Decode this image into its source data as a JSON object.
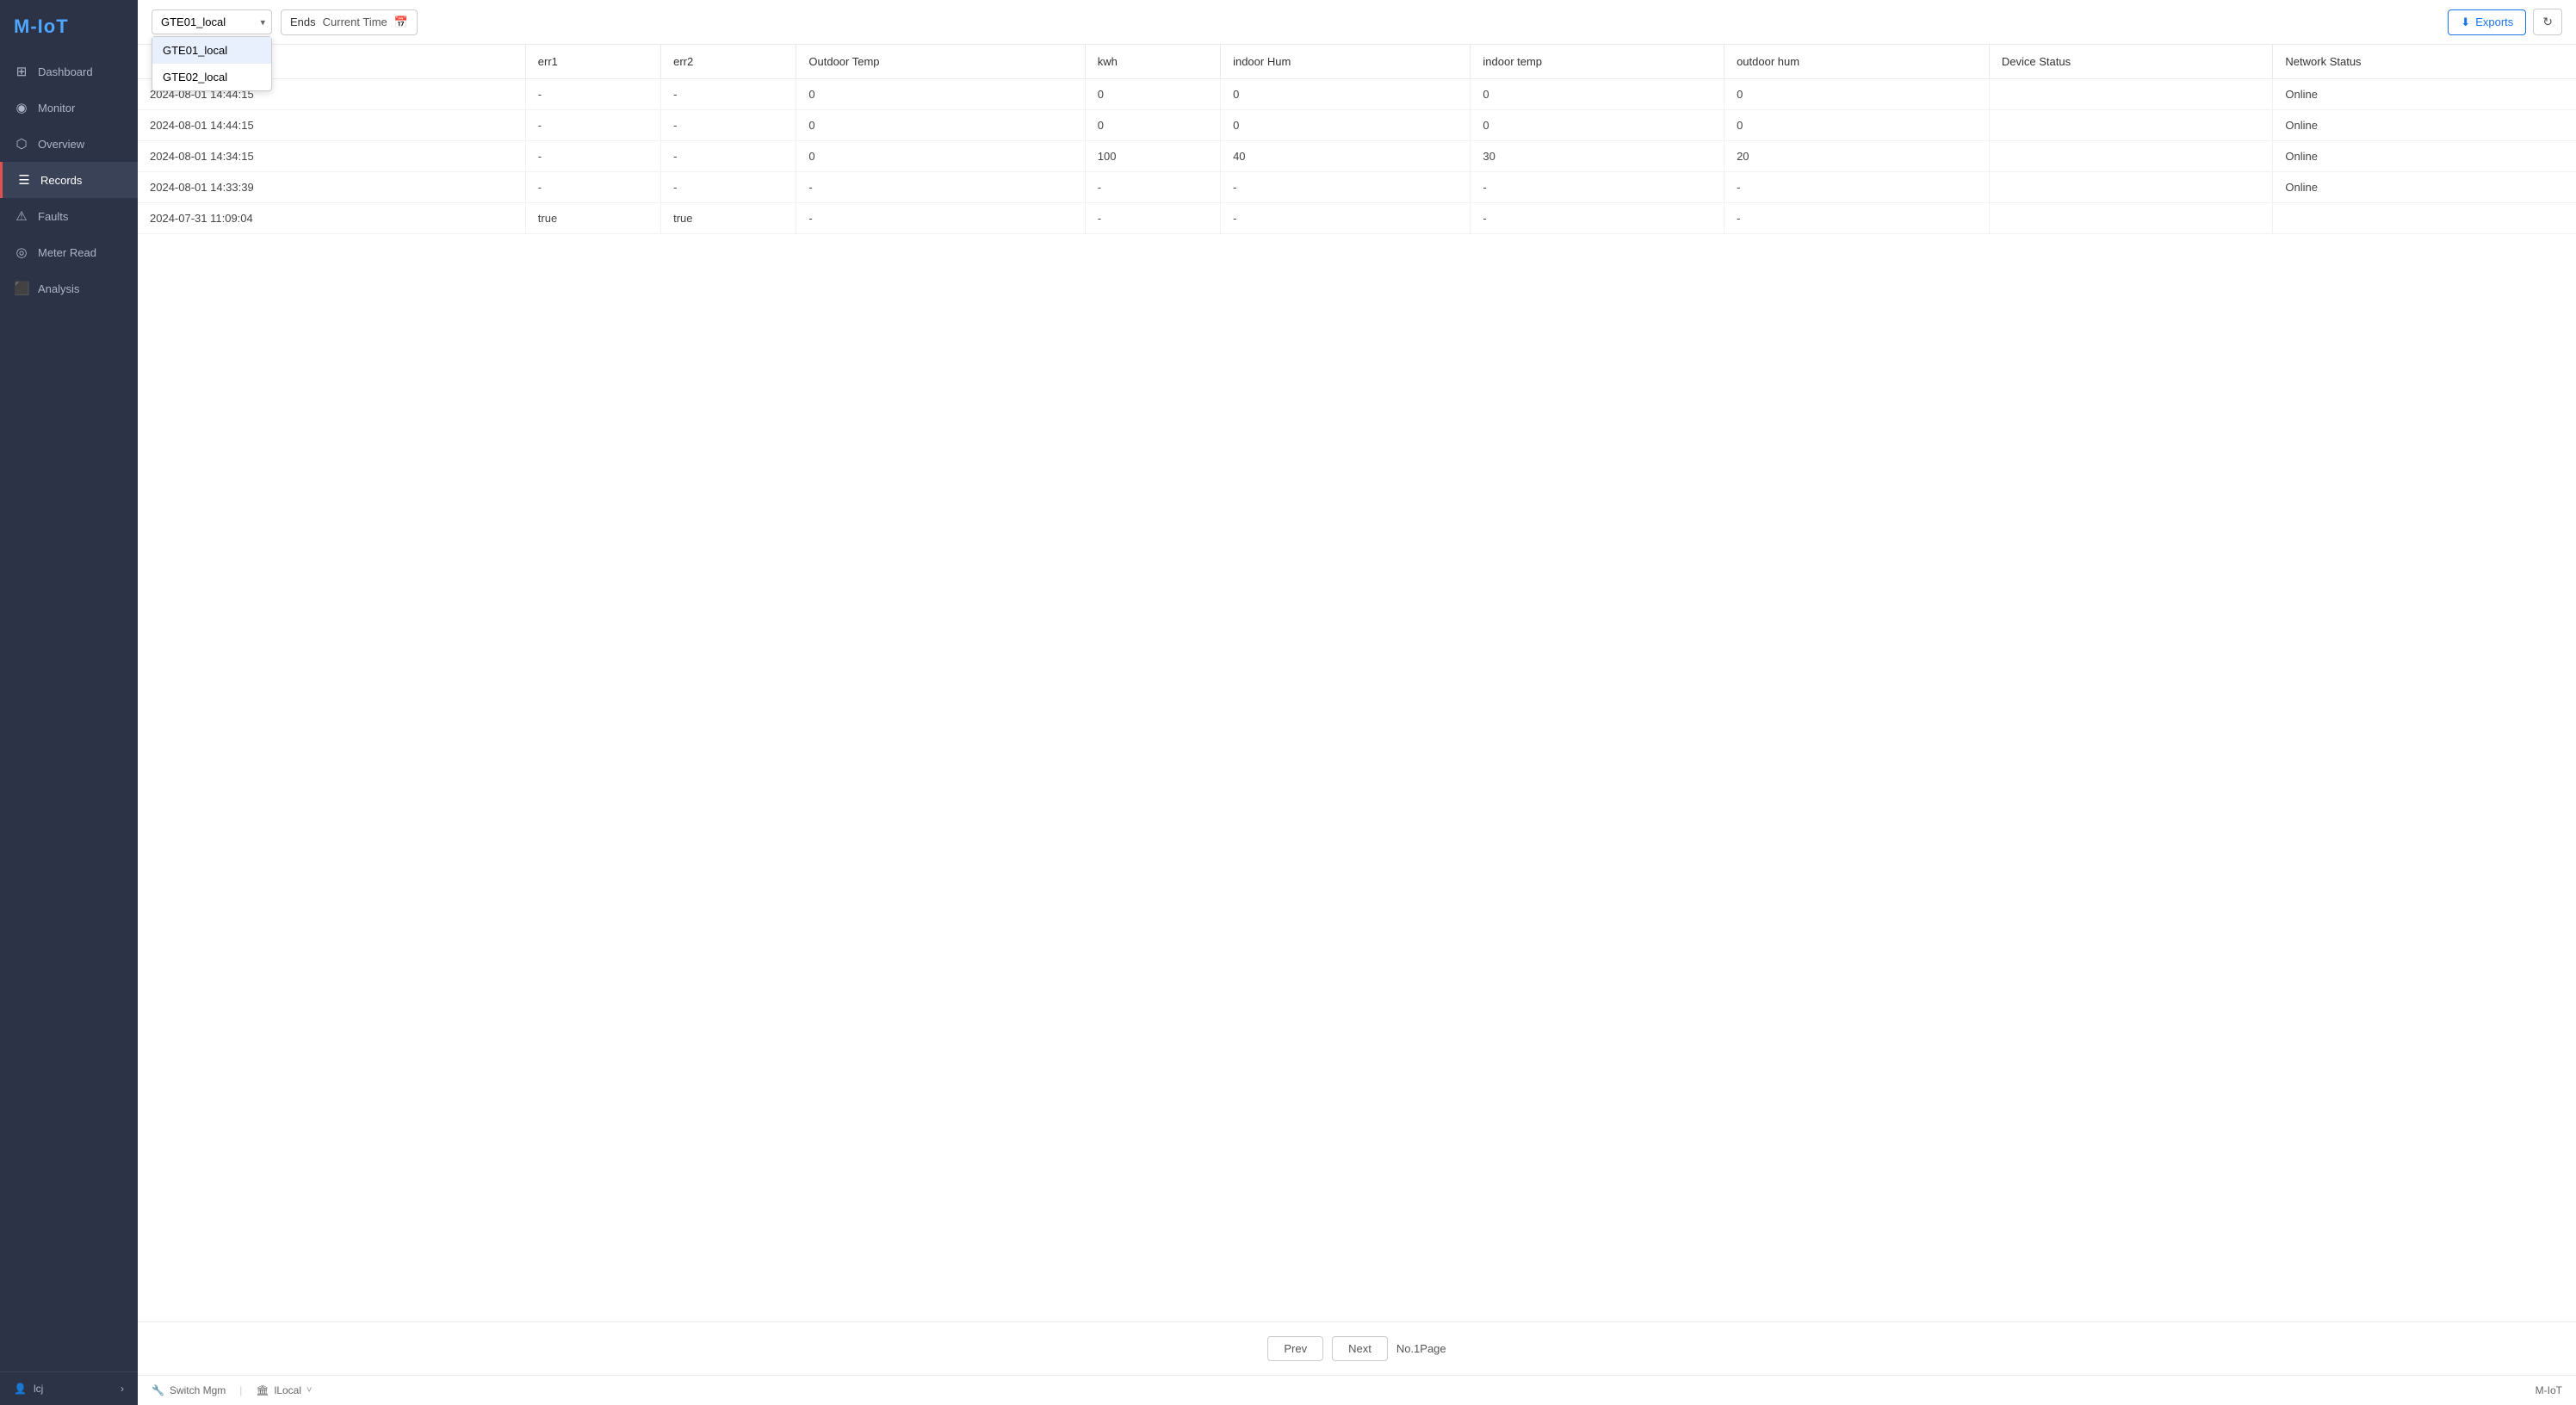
{
  "app": {
    "title": "M-IoT"
  },
  "sidebar": {
    "items": [
      {
        "id": "dashboard",
        "label": "Dashboard",
        "icon": "⊞",
        "active": false
      },
      {
        "id": "monitor",
        "label": "Monitor",
        "icon": "◉",
        "active": false
      },
      {
        "id": "overview",
        "label": "Overview",
        "icon": "⬡",
        "active": false
      },
      {
        "id": "records",
        "label": "Records",
        "icon": "☰",
        "active": true
      },
      {
        "id": "faults",
        "label": "Faults",
        "icon": "⚠",
        "active": false
      },
      {
        "id": "meter-read",
        "label": "Meter Read",
        "icon": "◎",
        "active": false
      },
      {
        "id": "analysis",
        "label": "Analysis",
        "icon": "⬛",
        "active": false
      }
    ],
    "footer": {
      "user": "lcj",
      "user_icon": "👤",
      "arrow_icon": "›"
    }
  },
  "toolbar": {
    "device_selected": "GTE01_local",
    "dropdown_options": [
      {
        "value": "GTE01_local",
        "label": "GTE01_local"
      },
      {
        "value": "GTE02_local",
        "label": "GTE02_local"
      }
    ],
    "date_filter": {
      "ends_label": "Ends",
      "current_time_label": "Current Time"
    },
    "export_label": "Exports",
    "refresh_icon": "↻"
  },
  "table": {
    "columns": [
      {
        "id": "timestamp",
        "label": ""
      },
      {
        "id": "err1",
        "label": "err1"
      },
      {
        "id": "err2",
        "label": "err2"
      },
      {
        "id": "outdoor_temp",
        "label": "Outdoor Temp"
      },
      {
        "id": "kwh",
        "label": "kwh"
      },
      {
        "id": "indoor_hum",
        "label": "indoor Hum"
      },
      {
        "id": "indoor_temp",
        "label": "indoor temp"
      },
      {
        "id": "outdoor_hum",
        "label": "outdoor hum"
      },
      {
        "id": "device_status",
        "label": "Device Status"
      },
      {
        "id": "network_status",
        "label": "Network Status"
      }
    ],
    "rows": [
      {
        "timestamp": "2024-08-01 14:44:15",
        "err1": "-",
        "err2": "-",
        "outdoor_temp": "0",
        "kwh": "0",
        "indoor_hum": "0",
        "indoor_temp": "0",
        "outdoor_hum": "0",
        "device_status": "",
        "network_status": "Online"
      },
      {
        "timestamp": "2024-08-01 14:44:15",
        "err1": "-",
        "err2": "-",
        "outdoor_temp": "0",
        "kwh": "0",
        "indoor_hum": "0",
        "indoor_temp": "0",
        "outdoor_hum": "0",
        "device_status": "",
        "network_status": "Online"
      },
      {
        "timestamp": "2024-08-01 14:34:15",
        "err1": "-",
        "err2": "-",
        "outdoor_temp": "0",
        "kwh": "100",
        "indoor_hum": "40",
        "indoor_temp": "30",
        "outdoor_hum": "20",
        "device_status": "",
        "network_status": "Online"
      },
      {
        "timestamp": "2024-08-01 14:33:39",
        "err1": "-",
        "err2": "-",
        "outdoor_temp": "-",
        "kwh": "-",
        "indoor_hum": "-",
        "indoor_temp": "-",
        "outdoor_hum": "-",
        "device_status": "",
        "network_status": "Online"
      },
      {
        "timestamp": "2024-07-31 11:09:04",
        "err1": "true",
        "err2": "true",
        "outdoor_temp": "-",
        "kwh": "-",
        "indoor_hum": "-",
        "indoor_temp": "-",
        "outdoor_hum": "-",
        "device_status": "",
        "network_status": ""
      }
    ]
  },
  "pagination": {
    "prev_label": "Prev",
    "next_label": "Next",
    "page_info": "No.1Page"
  },
  "bottom_bar": {
    "switch_icon": "🔧",
    "switch_label": "Switch Mgm",
    "building_icon": "🏛",
    "location_label": "lLocal",
    "chevron": "˅",
    "right_label": "M-IoT"
  }
}
